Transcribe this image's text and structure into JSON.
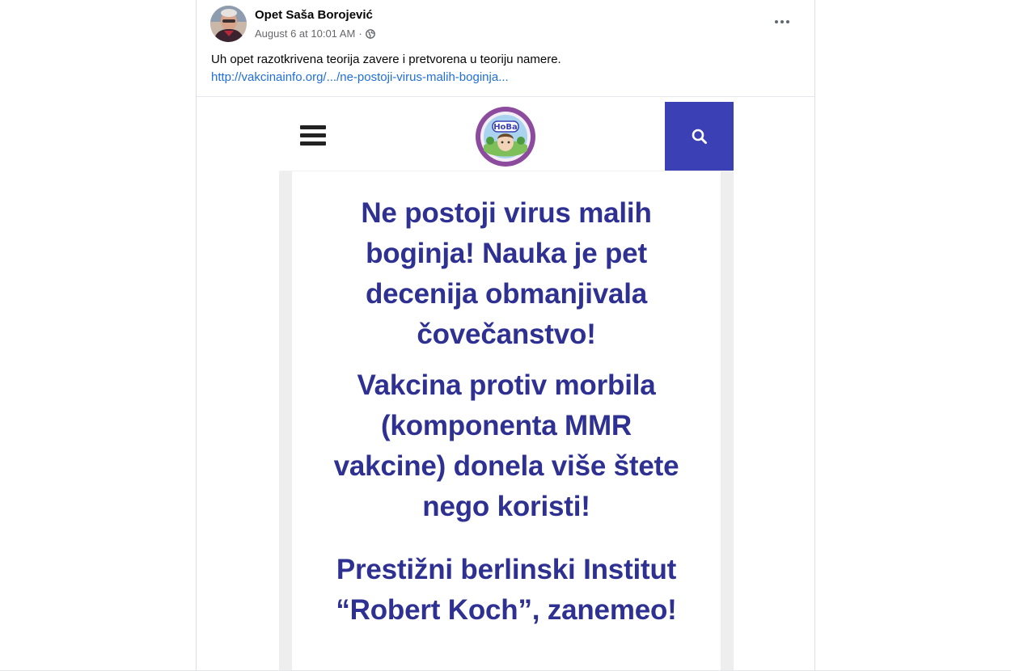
{
  "post": {
    "author": "Opet Saša Borojević",
    "timestamp": "August 6 at 10:01 AM",
    "meta_separator": "·",
    "privacy_icon": "globe-icon",
    "more_icon": "more-options-icon",
    "text": "Uh opet razotkrivena teorija zavere i pretvorena u teoriju namere.",
    "link": "http://vakcinainfo.org/.../ne-postoji-virus-malih-boginja..."
  },
  "embed": {
    "nav": {
      "menu_icon": "hamburger-menu-icon",
      "logo_text": "HoBa",
      "search_icon": "search-icon",
      "accent_color": "#3b41b5"
    },
    "article": {
      "headline_color": "#2e3192",
      "paragraphs": [
        {
          "lines": [
            "Ne postoji virus malih",
            "boginja! Nauka je pet",
            "decenija obmanjivala",
            "čovečanstvo!"
          ]
        },
        {
          "lines": [
            "Vakcina protiv morbila",
            "(komponenta MMR",
            "vakcine) donela više štete",
            "nego koristi!"
          ]
        },
        {
          "lines": [
            "Prestižni berlinski Institut",
            "“Robert Koch”, zanemeo!"
          ]
        }
      ]
    }
  }
}
